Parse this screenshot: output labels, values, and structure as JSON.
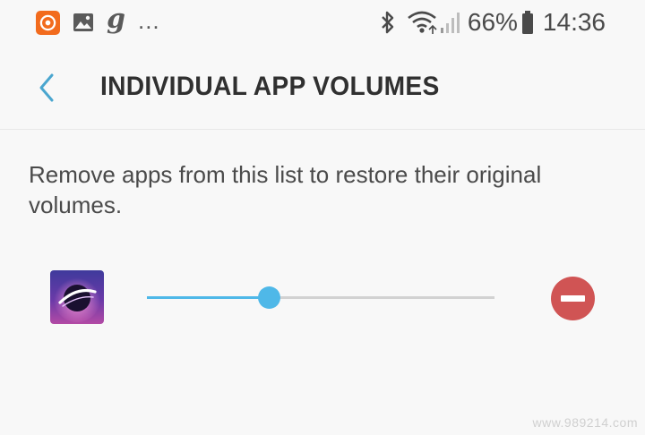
{
  "status_bar": {
    "battery_percent": "66%",
    "time": "14:36",
    "notification_letter": "g",
    "more_indicator": "...",
    "icons": [
      "orange-app-icon",
      "gallery-icon",
      "bluetooth-icon",
      "wifi-icon",
      "signal-icon",
      "battery-icon"
    ]
  },
  "header": {
    "title": "INDIVIDUAL APP VOLUMES",
    "back_icon": "chevron-left-icon"
  },
  "description": "Remove apps from this list to restore their original volumes.",
  "app_item": {
    "volume_fraction": 0.35,
    "remove_icon": "minus-circle-icon"
  },
  "colors": {
    "accent": "#4fb8e8",
    "track": "#d2d2d2",
    "remove": "#d05454",
    "notification_app": "#f26b1d",
    "background": "#f8f8f8"
  },
  "watermark": "www.989214.com"
}
